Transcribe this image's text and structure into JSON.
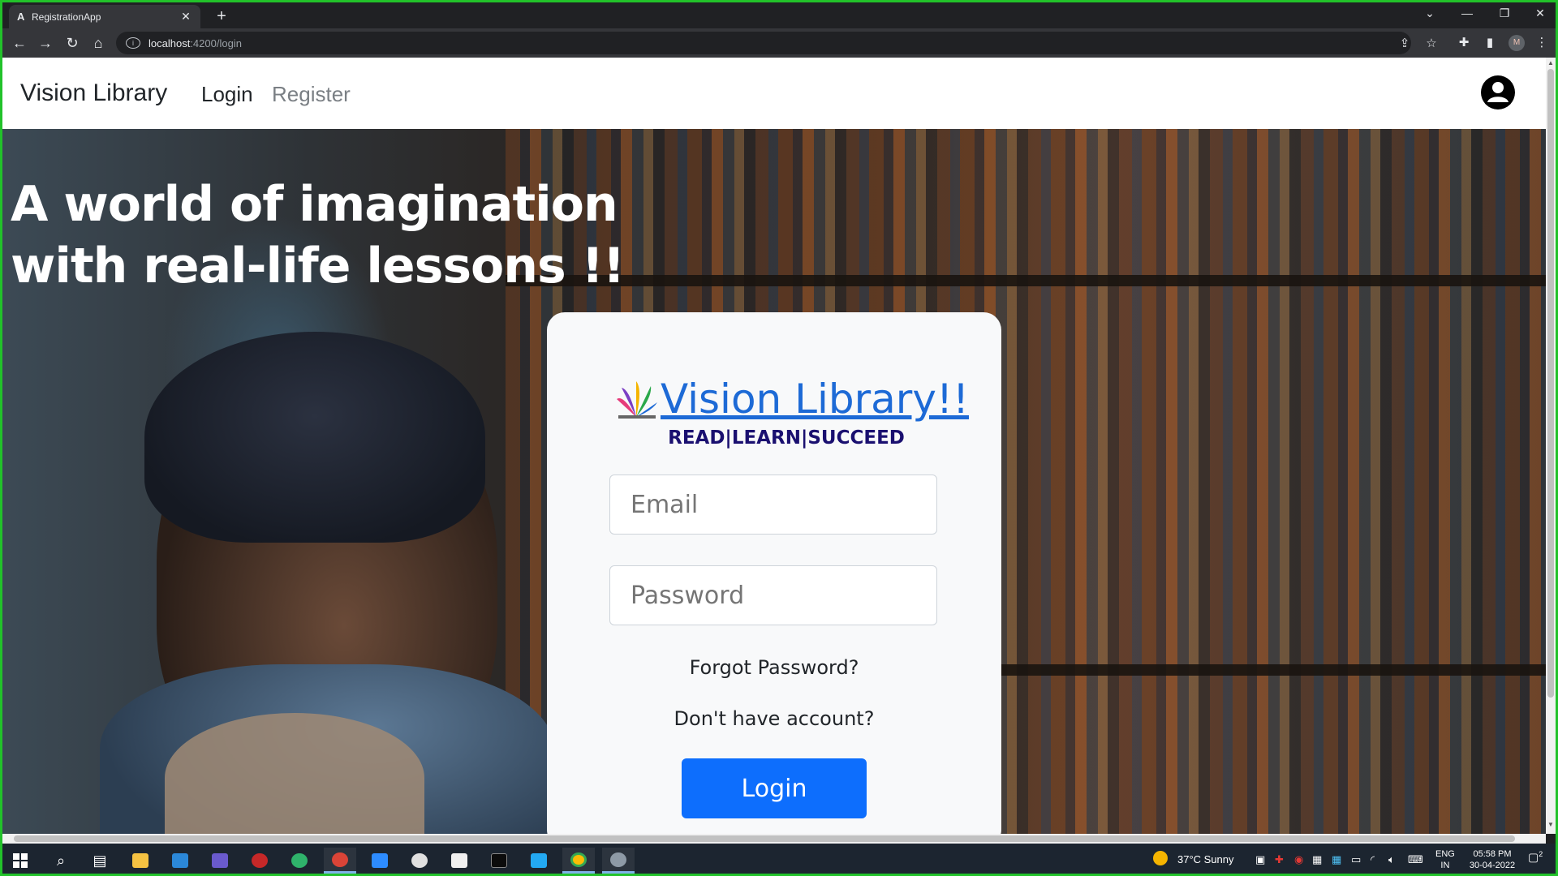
{
  "browser": {
    "tab_title": "RegistrationApp",
    "tab_favicon": "A",
    "url_host": "localhost",
    "url_path": ":4200/login",
    "profile_initial": "M"
  },
  "navbar": {
    "brand": "Vision Library",
    "links": [
      {
        "label": "Login"
      },
      {
        "label": "Register"
      }
    ]
  },
  "hero": {
    "headline": "A world of imagination with real-life lessons !!"
  },
  "login_card": {
    "logo_title": "Vision Library!!",
    "tagline": "READ|LEARN|SUCCEED",
    "email_placeholder": "Email",
    "password_placeholder": "Password",
    "forgot_link": "Forgot Password?",
    "no_account_link": "Don't have account?",
    "login_button": "Login"
  },
  "taskbar": {
    "weather": "37°C  Sunny",
    "lang_top": "ENG",
    "lang_bottom": "IN",
    "time": "05:58 PM",
    "date": "30-04-2022",
    "notifications": "2"
  },
  "colors": {
    "primary": "#0d6efd",
    "logo_blue": "#1d6ad6",
    "tagline_navy": "#1a1070",
    "screen_border": "#22c22a"
  }
}
